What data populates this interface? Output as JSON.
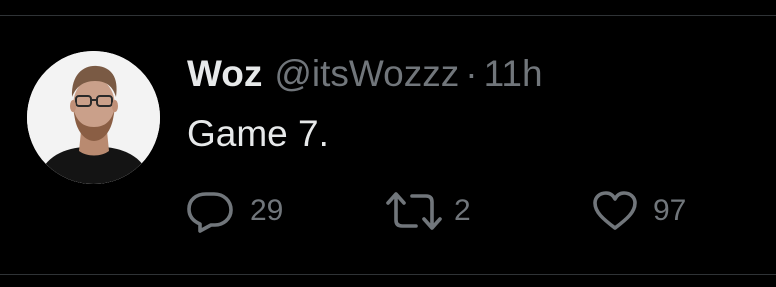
{
  "tweet": {
    "author_name": "Woz",
    "author_handle": "@itsWozzz",
    "separator": "·",
    "timestamp": "11h",
    "text": "Game 7."
  },
  "actions": {
    "reply_count": "29",
    "retweet_count": "2",
    "like_count": "97"
  },
  "icons": {
    "reply": "speech-bubble-icon",
    "retweet": "retweet-arrows-icon",
    "like": "heart-outline-icon"
  },
  "colors": {
    "background": "#000000",
    "primary_text": "#e7e9ea",
    "secondary_text": "#71767b",
    "divider": "#2f3336"
  }
}
